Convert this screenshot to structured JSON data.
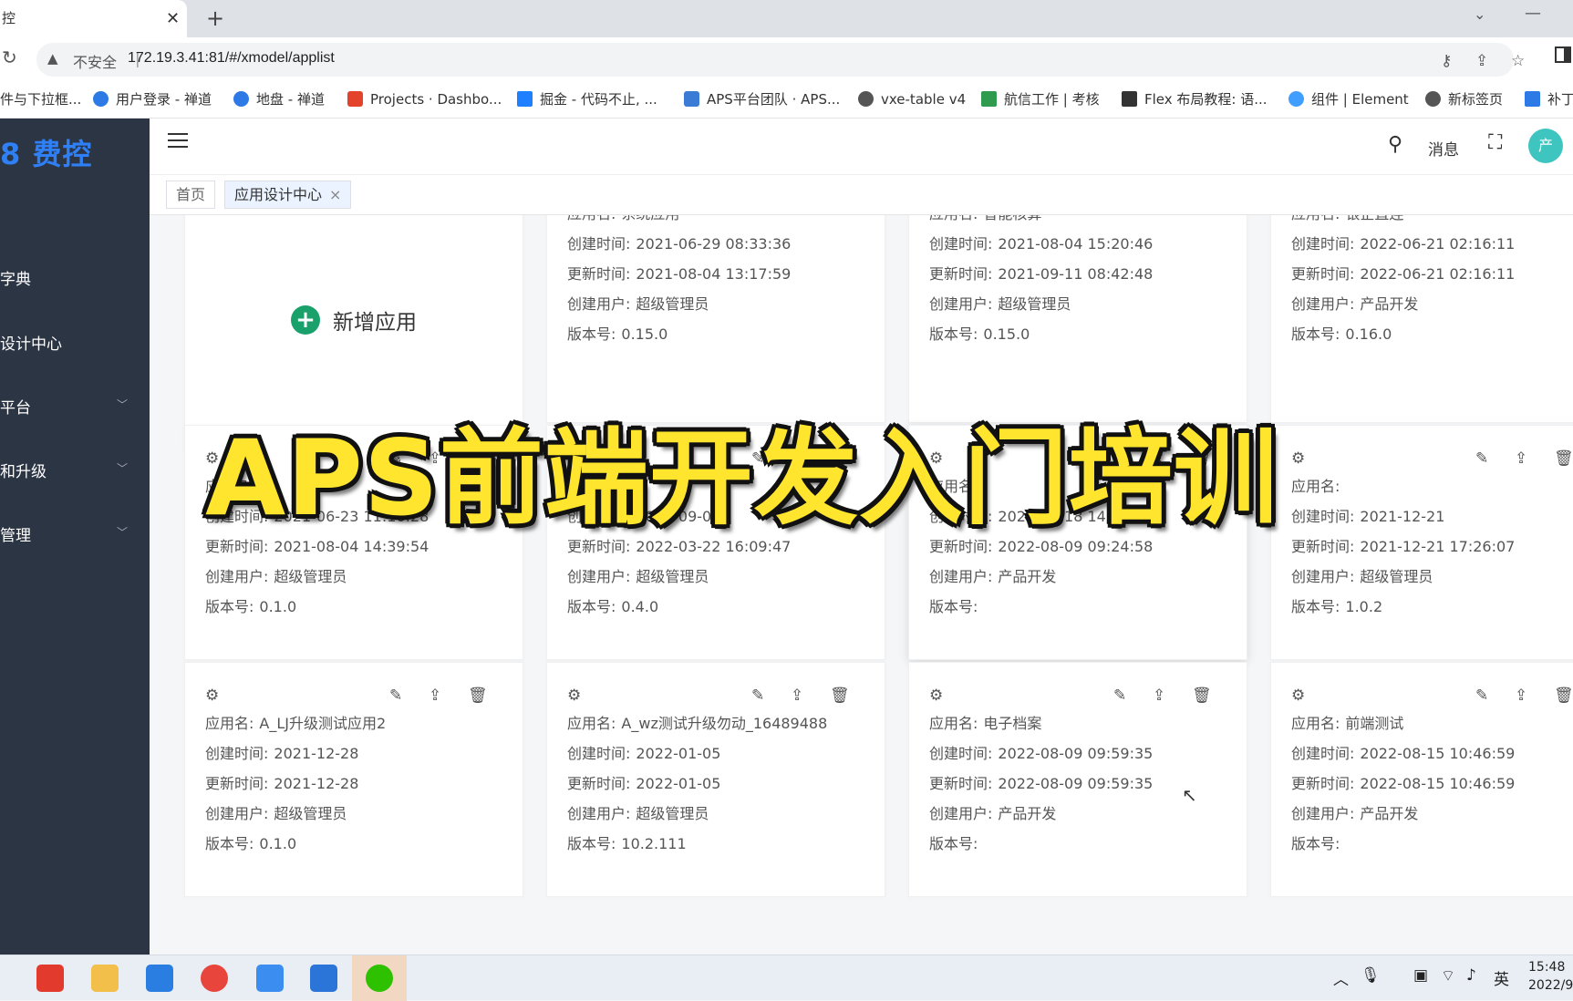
{
  "browser": {
    "tab_title": "控",
    "new_tab": "+",
    "insecure": "不安全",
    "url": "172.19.3.41:81/#/xmodel/applist"
  },
  "bookmarks": [
    {
      "label": "件与下拉框...",
      "color": "#ffffff"
    },
    {
      "label": "用户登录 - 禅道",
      "color": "#2d7ae6"
    },
    {
      "label": "地盘 - 禅道",
      "color": "#2d7ae6"
    },
    {
      "label": "Projects · Dashbo...",
      "color": "#e2432a"
    },
    {
      "label": "掘金 - 代码不止, ...",
      "color": "#1e80ff"
    },
    {
      "label": "APS平台团队 · APS...",
      "color": "#3a7bd5"
    },
    {
      "label": "vxe-table v4",
      "color": "#555555"
    },
    {
      "label": "航信工作 | 考核",
      "color": "#2e9b4f"
    },
    {
      "label": "Flex 布局教程: 语...",
      "color": "#333333"
    },
    {
      "label": "组件 | Element",
      "color": "#409eff"
    },
    {
      "label": "新标签页",
      "color": "#555555"
    },
    {
      "label": "补丁",
      "color": "#2d7ae6"
    }
  ],
  "sidebar": {
    "logo": "8 费控",
    "items": [
      {
        "label": "字典",
        "chevron": false
      },
      {
        "label": "设计中心",
        "chevron": false
      },
      {
        "label": "平台",
        "chevron": true
      },
      {
        "label": "和升级",
        "chevron": true
      },
      {
        "label": "管理",
        "chevron": true
      }
    ]
  },
  "header": {
    "messages": "消息",
    "avatar": "产"
  },
  "tags": [
    {
      "label": "首页"
    },
    {
      "label": "应用设计中心",
      "close": "×"
    }
  ],
  "add_app": {
    "label": "新增应用",
    "plus": "+"
  },
  "field_labels": {
    "name": "应用名:",
    "created": "创建时间:",
    "updated": "更新时间:",
    "user": "创建用户:",
    "version": "版本号:"
  },
  "cards": [
    {
      "name": "系统应用",
      "created": "2021-06-29 08:33:36",
      "updated": "2021-08-04 13:17:59",
      "user": "超级管理员",
      "version": "0.15.0"
    },
    {
      "name": "智能核算",
      "created": "2021-08-04 15:20:46",
      "updated": "2021-09-11 08:42:48",
      "user": "超级管理员",
      "version": "0.15.0"
    },
    {
      "name": "银企直连",
      "created": "2022-06-21 02:16:11",
      "updated": "2022-06-21 02:16:11",
      "user": "产品开发",
      "version": "0.16.0"
    },
    {
      "name": "",
      "created": "2021-06-23 11:16:28",
      "updated": "2021-08-04 14:39:54",
      "user": "超级管理员",
      "version": "0.1.0"
    },
    {
      "name": "",
      "created": "2021-09-06",
      "updated": "2022-03-22 16:09:47",
      "user": "超级管理员",
      "version": "0.4.0"
    },
    {
      "name": "",
      "created": "2022-07-18 14:12:16",
      "updated": "2022-08-09 09:24:58",
      "user": "产品开发",
      "version": ""
    },
    {
      "name": "",
      "created": "2021-12-21",
      "updated": "2021-12-21 17:26:07",
      "user": "超级管理员",
      "version": "1.0.2"
    },
    {
      "name": "A_LJ升级测试应用2",
      "created": "2021-12-28",
      "updated": "2021-12-28",
      "user": "超级管理员",
      "version": "0.1.0"
    },
    {
      "name": "A_wz测试升级勿动_16489488",
      "created": "2022-01-05",
      "updated": "2022-01-05",
      "user": "超级管理员",
      "version": "10.2.111"
    },
    {
      "name": "电子档案",
      "created": "2022-08-09 09:59:35",
      "updated": "2022-08-09 09:59:35",
      "user": "产品开发",
      "version": ""
    },
    {
      "name": "前端测试",
      "created": "2022-08-15 10:46:59",
      "updated": "2022-08-15 10:46:59",
      "user": "产品开发",
      "version": ""
    }
  ],
  "banner": "APS前端开发入门培训",
  "taskbar": {
    "lang": "英",
    "time": "15:48",
    "date": "2022/9"
  }
}
